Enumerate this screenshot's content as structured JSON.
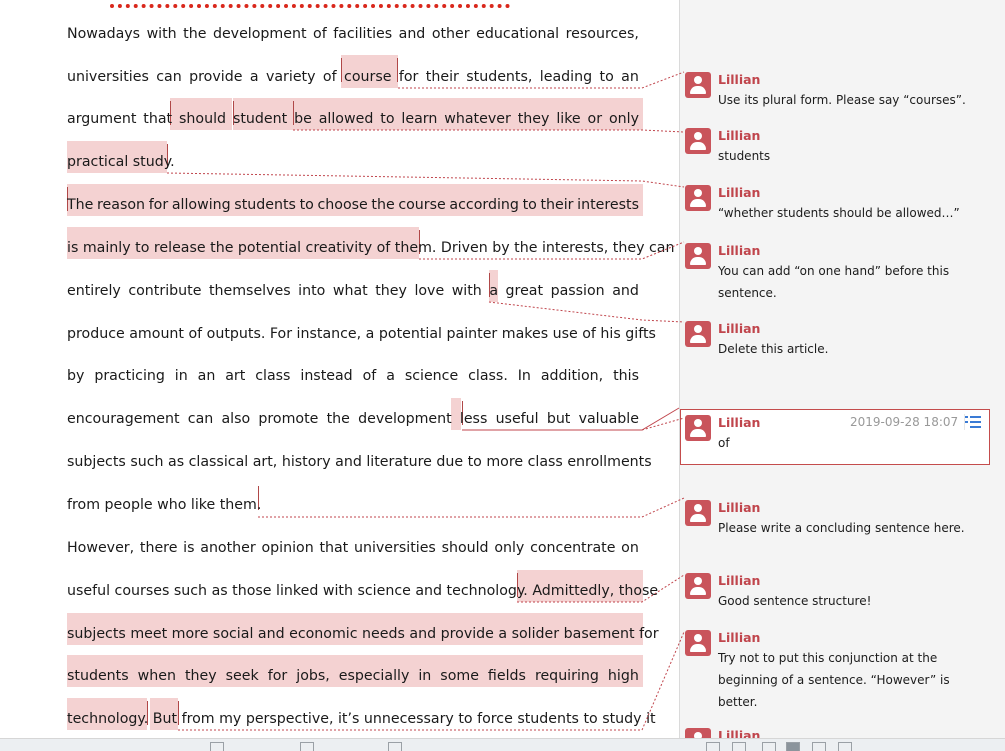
{
  "document": {
    "lines": [
      [
        "Nowadays",
        "with",
        "the",
        "development",
        "of",
        "facilities",
        "and",
        "other",
        "educational",
        "resources,"
      ],
      [
        "universities",
        "can",
        "provide",
        "a",
        "variety",
        "of",
        "course",
        "for",
        "their",
        "students,",
        "leading",
        "to",
        "an"
      ],
      [
        "argument",
        "that",
        "should",
        "student",
        "be",
        "allowed",
        "to",
        "learn",
        "whatever",
        "they",
        "like",
        "or",
        "only"
      ],
      [
        "practical study."
      ],
      [
        "The",
        "reason",
        "for",
        "allowing",
        "students",
        "to",
        "choose",
        "the",
        "course",
        "according",
        "to",
        "their",
        "interests"
      ],
      [
        "is mainly to release the potential creativity of them. Driven by the interests, they can"
      ],
      [
        "entirely",
        "contribute",
        "themselves",
        "into",
        "what",
        "they",
        "love",
        "with",
        "a",
        "great",
        "passion",
        "and"
      ],
      [
        "produce amount of outputs. For instance, a potential painter makes use of his gifts"
      ],
      [
        "by",
        "practicing",
        "in",
        "an",
        "art",
        "class",
        "instead",
        "of",
        "a",
        "science",
        "class.",
        "In",
        "addition,",
        "this"
      ],
      [
        "encouragement",
        "can",
        "also",
        "promote",
        "the",
        "development",
        "less",
        "useful",
        "but",
        "valuable"
      ],
      [
        "subjects such as classical art, history and literature due to more class enrollments"
      ],
      [
        "from people who like them."
      ],
      [
        "However,",
        "there",
        "is",
        "another",
        "opinion",
        "that",
        "universities",
        "should",
        "only",
        "concentrate",
        "on"
      ],
      [
        "useful courses such as those linked with science and technology. Admittedly, those"
      ],
      [
        "subjects meet more social and economic needs and provide a solider basement for"
      ],
      [
        "students",
        "when",
        "they",
        "seek",
        "for",
        "jobs,",
        "especially",
        "in",
        "some",
        "fields",
        "requiring",
        "high"
      ],
      [
        "technology. But from my perspective, it’s unnecessary to force students to study it"
      ]
    ]
  },
  "comments": [
    {
      "author": "Lillian",
      "text": "Use its plural form. Please say “courses”."
    },
    {
      "author": "Lillian",
      "text": "students"
    },
    {
      "author": "Lillian",
      "text": "“whether students should be allowed…”"
    },
    {
      "author": "Lillian",
      "text": "You can add “on one hand” before this sentence."
    },
    {
      "author": "Lillian",
      "text": "Delete this article."
    },
    {
      "author": "Lillian",
      "text": "of",
      "date": "2019-09-28 18:07",
      "active": true
    },
    {
      "author": "Lillian",
      "text": "Please write a concluding sentence here."
    },
    {
      "author": "Lillian",
      "text": "Good sentence structure!"
    },
    {
      "author": "Lillian",
      "text": "Try not to put this conjunction at the beginning of a sentence. “However” is better."
    },
    {
      "author": "Lillian",
      "text": ""
    }
  ],
  "icons": {
    "comment_menu": "list-menu-icon",
    "avatar": "user-avatar-icon"
  },
  "colors": {
    "highlight": "#f4d2d2",
    "accent": "#c0454c",
    "connector": "#c0454c"
  }
}
